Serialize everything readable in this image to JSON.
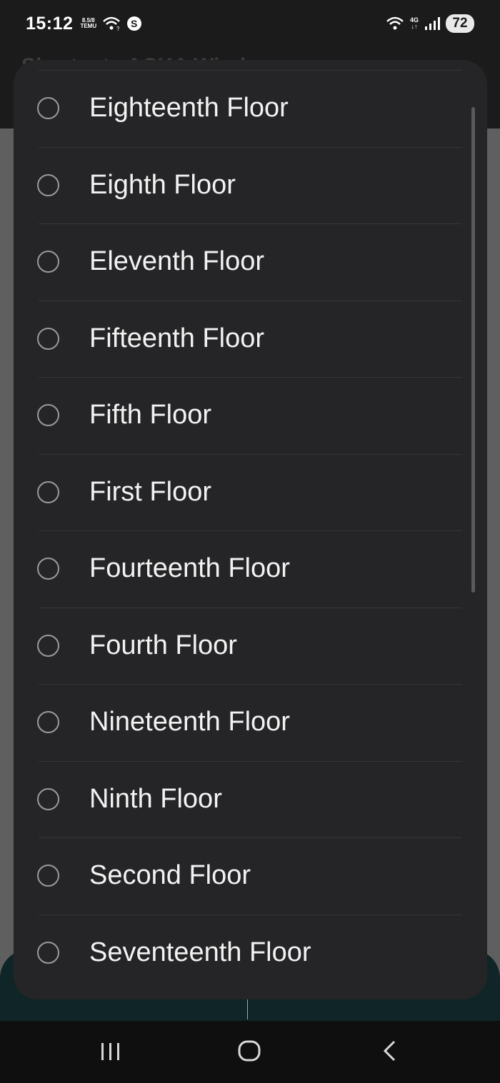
{
  "status_bar": {
    "time": "15:12",
    "temu_badge_top": "8.5/8",
    "temu_badge_bottom": "TEMU",
    "network_type": "4G",
    "battery": "72"
  },
  "app": {
    "title": "Shortcuts ACKA Windows"
  },
  "dialog": {
    "options": [
      {
        "label": "Eighteenth Floor",
        "selected": false
      },
      {
        "label": "Eighth Floor",
        "selected": false
      },
      {
        "label": "Eleventh Floor",
        "selected": false
      },
      {
        "label": "Fifteenth Floor",
        "selected": false
      },
      {
        "label": "Fifth Floor",
        "selected": false
      },
      {
        "label": "First Floor",
        "selected": false
      },
      {
        "label": "Fourteenth Floor",
        "selected": false
      },
      {
        "label": "Fourth Floor",
        "selected": false
      },
      {
        "label": "Nineteenth Floor",
        "selected": false
      },
      {
        "label": "Ninth Floor",
        "selected": false
      },
      {
        "label": "Second Floor",
        "selected": false
      },
      {
        "label": "Seventeenth Floor",
        "selected": false
      }
    ]
  },
  "nav_bar": {
    "icons": [
      "recent-apps-icon",
      "home-icon",
      "back-icon"
    ]
  }
}
